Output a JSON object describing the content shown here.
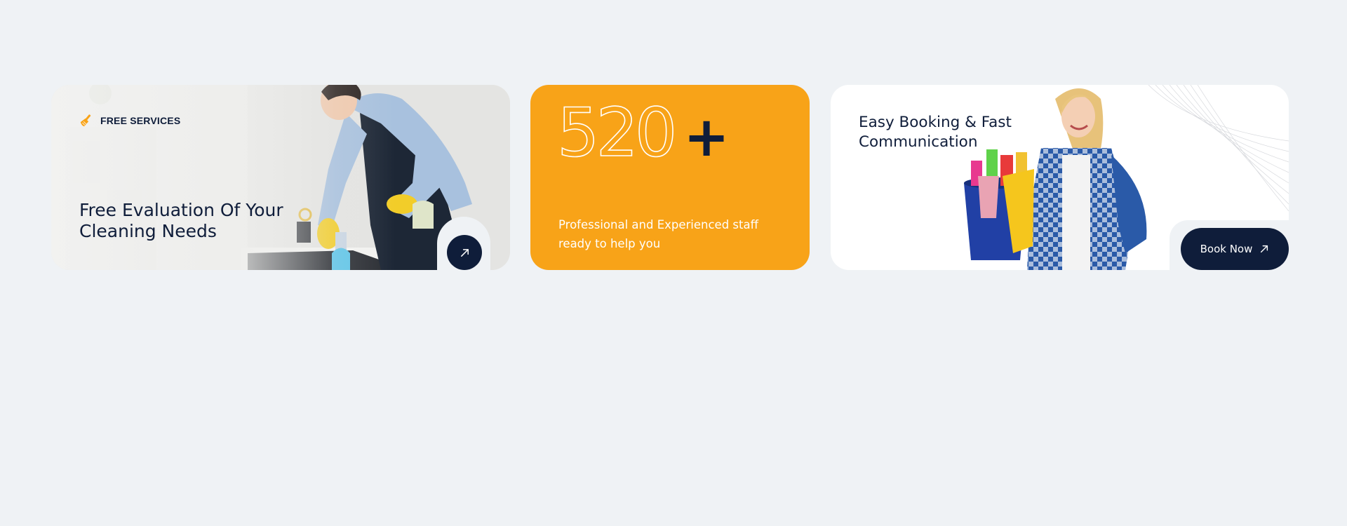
{
  "cards": {
    "evaluation": {
      "tag_icon": "broom-icon",
      "tag_label": "FREE SERVICES",
      "heading": "Free Evaluation Of Your Cleaning Needs",
      "action_icon": "arrow-up-right-icon"
    },
    "stats": {
      "number": "520",
      "suffix": "+",
      "description": "Professional and Experienced staff ready to help you"
    },
    "booking": {
      "heading": "Easy Booking & Fast Communication",
      "button_label": "Book Now",
      "button_icon": "arrow-up-right-icon"
    }
  },
  "colors": {
    "page_background": "#eff2f5",
    "navy": "#0f1d3a",
    "accent_orange": "#f8a318",
    "card_white": "#ffffff"
  }
}
